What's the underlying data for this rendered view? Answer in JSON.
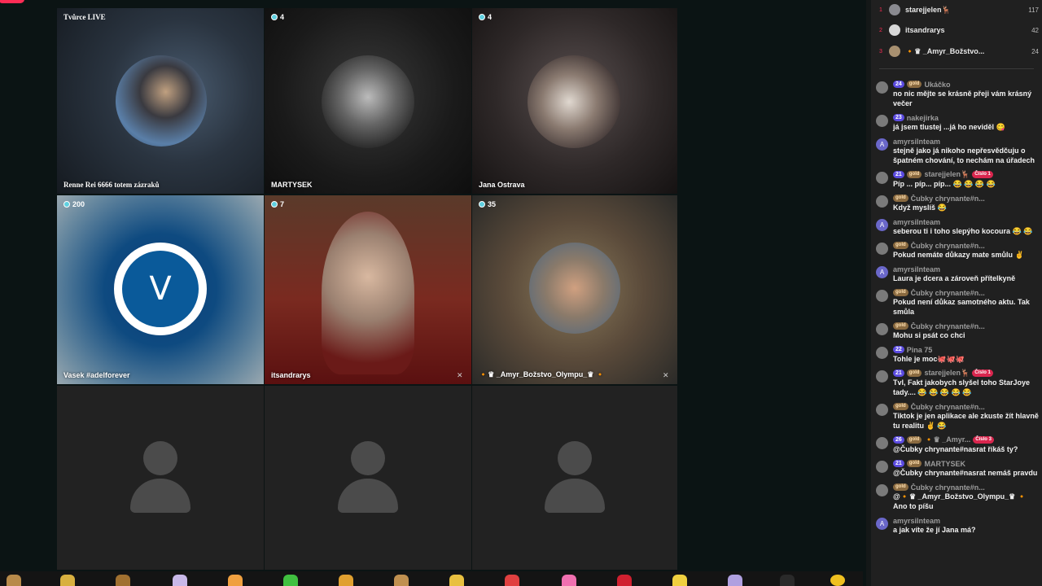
{
  "tiles": [
    {
      "label": "Renne Rei 6666 totem zázraků",
      "top_label": "Tvůrce LIVE"
    },
    {
      "label": "MARTYSEK",
      "count": "4"
    },
    {
      "label": "Jana Ostrava",
      "count": "4"
    },
    {
      "label": "Vasek #adelforever",
      "count": "200",
      "avatar_letter": "V"
    },
    {
      "label": "itsandrarys",
      "count": "7"
    },
    {
      "label": "🔸♛ _Amyr_Božstvo_Olympu_♛ 🔸",
      "count": "35"
    }
  ],
  "ranking": [
    {
      "rank": "1",
      "name": "starejjelen🦌",
      "score": "117"
    },
    {
      "rank": "2",
      "name": "itsandrarys",
      "score": "42"
    },
    {
      "rank": "3",
      "name": "🔸♛ _Amyr_Božstvo...",
      "score": "24"
    }
  ],
  "chat": [
    {
      "lvl": "24",
      "gold": "gold",
      "user": "Ukáčko",
      "text": "no nic mějte se krásně přeji vám krásný večer"
    },
    {
      "lvl": "23",
      "user": "nakejirka",
      "text": "já jsem tlustej ...já ho neviděl 😋"
    },
    {
      "user": "amyrsilnteam",
      "text": "stejně jako já nikoho nepřesvědčuju o špatném chování, to nechám na úřadech",
      "letter": "A"
    },
    {
      "lvl": "21",
      "gold": "gold",
      "user": "starejjelen🦌",
      "cislo": "Číslo 1",
      "text": "Píp ... píp... píp... 😂 😂 😂 😂"
    },
    {
      "gold": "gold",
      "user": "Čubky chrynante#n...",
      "text": "Když myslíš 😂"
    },
    {
      "user": "amyrsilnteam",
      "text": "seberou ti i toho slepýho kocoura 😂 😂",
      "letter": "A"
    },
    {
      "gold": "gold",
      "user": "Čubky chrynante#n...",
      "text": "Pokud nemáte důkazy mate smůlu ✌"
    },
    {
      "user": "amyrsilnteam",
      "text": "Laura je dcera a zároveň přítelkyně",
      "letter": "A"
    },
    {
      "gold": "gold",
      "user": "Čubky chrynante#n...",
      "text": "Pokud není důkaz samotného aktu. Tak smůla"
    },
    {
      "gold": "gold",
      "user": "Čubky chrynante#n...",
      "text": "Mohu si psát co chci"
    },
    {
      "lvl": "22",
      "user": "Pina 75",
      "text": "Tohle je moc🐙🐙🐙"
    },
    {
      "lvl": "21",
      "gold": "gold",
      "user": "starejjelen🦌",
      "cislo": "Číslo 1",
      "text": "Tvl, Fakt jakobych slyšel toho StarJoye tady.... 😂 😂 😂 😂 😂"
    },
    {
      "gold": "gold",
      "user": "Čubky chrynante#n...",
      "text": "Tiktok je jen aplikace ale zkuste žít hlavně tu realitu ✌ 😂"
    },
    {
      "lvl": "26",
      "gold": "gold",
      "user": "🔸♛ _Amyr...",
      "cislo": "Číslo 3",
      "text": "@Čubky chrynante#nasrat říkáš ty?"
    },
    {
      "lvl": "21",
      "gold": "gold",
      "user": "MARTYSEK",
      "text": "@Čubky chrynante#nasrat nemáš pravdu"
    },
    {
      "gold": "gold",
      "user": "Čubky chrynante#n...",
      "text": "@🔸♛ _Amyr_Božstvo_Olympu_♛ 🔸 Ano to píšu"
    },
    {
      "user": "amyrsilnteam",
      "text": "a jak víte že jí Jana má?",
      "letter": "A"
    }
  ],
  "colors": {
    "accent": "#fe2c55",
    "level_badge": "#5b4be0",
    "background": "#0b1414",
    "panel": "#202020"
  }
}
